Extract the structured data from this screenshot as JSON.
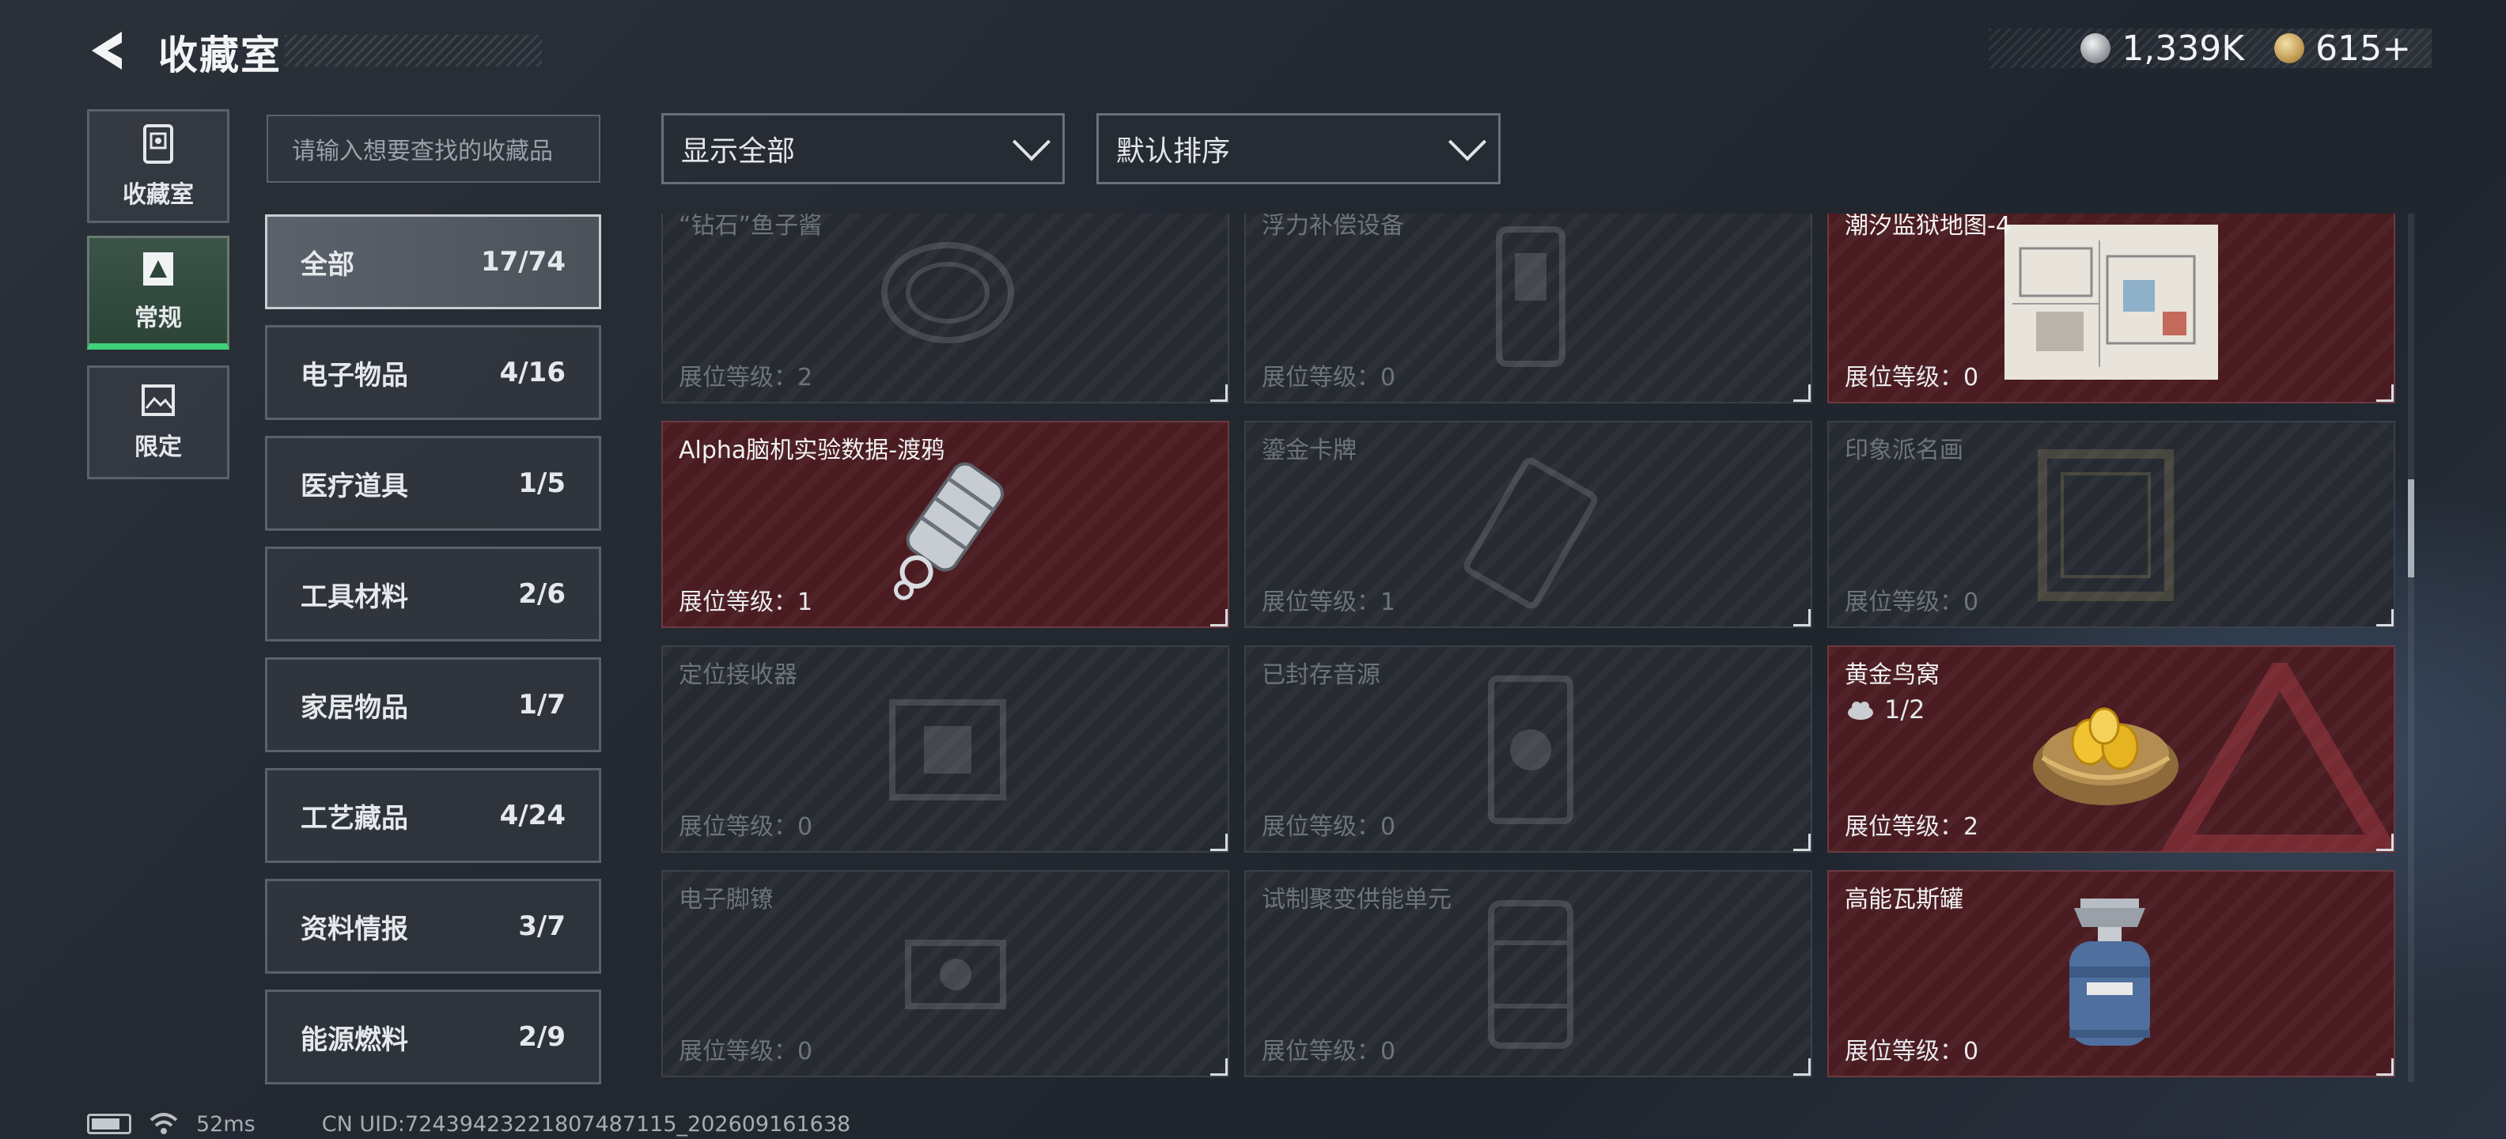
{
  "header": {
    "title": "收藏室",
    "currency": [
      {
        "icon": "silver-coin-icon",
        "value": "1,339K"
      },
      {
        "icon": "gold-coin-icon",
        "value": "615+"
      }
    ]
  },
  "rail": [
    {
      "label": "收藏室",
      "icon": "cabinet-icon"
    },
    {
      "label": "常规",
      "icon": "triangle-card-icon",
      "active": true
    },
    {
      "label": "限定",
      "icon": "picture-icon"
    }
  ],
  "search": {
    "placeholder": "请输入想要查找的收藏品"
  },
  "categories": [
    {
      "label": "全部",
      "count": "17/74",
      "active": true
    },
    {
      "label": "电子物品",
      "count": "4/16"
    },
    {
      "label": "医疗道具",
      "count": "1/5"
    },
    {
      "label": "工具材料",
      "count": "2/6"
    },
    {
      "label": "家居物品",
      "count": "1/7"
    },
    {
      "label": "工艺藏品",
      "count": "4/24"
    },
    {
      "label": "资料情报",
      "count": "3/7"
    },
    {
      "label": "能源燃料",
      "count": "2/9"
    }
  ],
  "filters": {
    "show": "显示全部",
    "sort": "默认排序"
  },
  "items": [
    {
      "name": "“钻石”鱼子酱",
      "level": "展位等级：2",
      "owned": false
    },
    {
      "name": "浮力补偿设备",
      "level": "展位等级：0",
      "owned": false
    },
    {
      "name": "潮汐监狱地图-4",
      "level": "展位等级：0",
      "owned": true
    },
    {
      "name": "Alpha脑机实验数据-渡鸦",
      "level": "展位等级：1",
      "owned": true
    },
    {
      "name": "鎏金卡牌",
      "level": "展位等级：1",
      "owned": false
    },
    {
      "name": "印象派名画",
      "level": "展位等级：0",
      "owned": false
    },
    {
      "name": "定位接收器",
      "level": "展位等级：0",
      "owned": false
    },
    {
      "name": "已封存音源",
      "level": "展位等级：0",
      "owned": false
    },
    {
      "name": "黄金鸟窝",
      "level": "展位等级：2",
      "owned": true,
      "count": "1/2"
    },
    {
      "name": "电子脚镣",
      "level": "展位等级：0",
      "owned": false
    },
    {
      "name": "试制聚变供能单元",
      "level": "展位等级：0",
      "owned": false
    },
    {
      "name": "高能瓦斯罐",
      "level": "展位等级：0",
      "owned": true
    }
  ],
  "status": {
    "ping": "52ms",
    "uid": "CN UID:7243942322180748711​5_202609161638"
  }
}
